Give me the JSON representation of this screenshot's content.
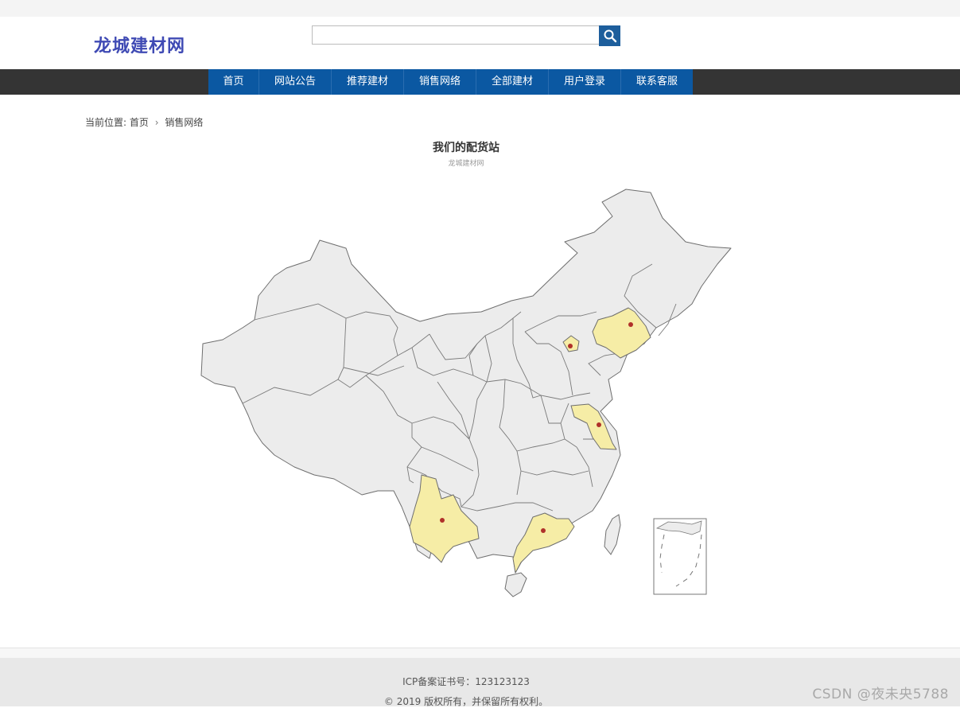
{
  "header": {
    "logo": "龙城建材网",
    "search": {
      "value": "",
      "placeholder": ""
    }
  },
  "nav": {
    "items": [
      {
        "label": "首页"
      },
      {
        "label": "网站公告"
      },
      {
        "label": "推荐建材"
      },
      {
        "label": "销售网络"
      },
      {
        "label": "全部建材"
      },
      {
        "label": "用户登录"
      },
      {
        "label": "联系客服"
      }
    ]
  },
  "breadcrumb": {
    "prefix": "当前位置:",
    "home": "首页",
    "current": "销售网络"
  },
  "map": {
    "title": "我们的配货站",
    "subtitle": "龙城建材网",
    "colors": {
      "base_fill": "#ececec",
      "border": "#6e6e6e",
      "highlight_fill": "#f6eda6",
      "marker": "#b0312a"
    }
  },
  "footer": {
    "icp": "ICP备案证书号：123123123",
    "copyright": "© 2019 版权所有，并保留所有权利。"
  },
  "watermark": "CSDN @夜未央5788"
}
